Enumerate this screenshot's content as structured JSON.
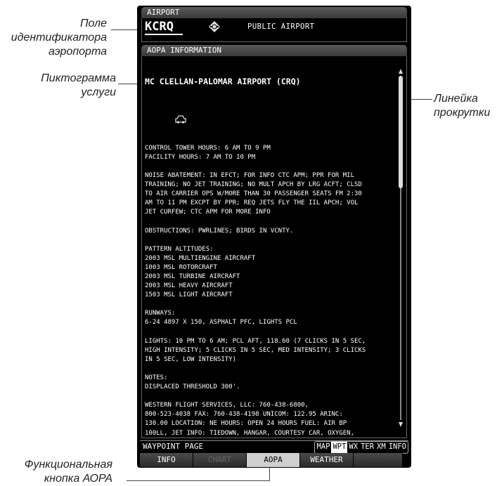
{
  "callouts": {
    "ident_field": [
      "Поле",
      "идентификатора",
      "аэропорта"
    ],
    "service_icon": [
      "Пиктограмма",
      "услуги"
    ],
    "scroll_bar": [
      "Линейка",
      "прокрутки"
    ],
    "aopa_softkey": [
      "Функциональная",
      "кнопка АОРА"
    ]
  },
  "airport": {
    "header": "AIRPORT",
    "identifier": "KCRQ",
    "icon": "public-airport-icon",
    "type": "PUBLIC AIRPORT"
  },
  "aopa": {
    "header": "AOPA INFORMATION",
    "title": "MC CLELLAN-PALOMAR AIRPORT (CRQ)",
    "service_icon": "car-icon",
    "lines": [
      "",
      "CONTROL TOWER HOURS: 6 AM TO 9 PM",
      "FACILITY HOURS: 7 AM TO 10 PM",
      "",
      "NOISE ABATEMENT: IN EFCT; FOR INFO CTC APM; PPR FOR MIL",
      "TRAINING; NO JET TRAINING; NO MULT APCH BY LRG ACFT; CLSD",
      "TO AIR CARRIER OPS W/MORE THAN 30 PASSENGER SEATS FM 2:30",
      "AM TO 11 PM EXCPT BY PPR; REQ JETS FLY THE IIL APCH; VOL",
      "JET CURFEW; CTC APM FOR MORE INFO",
      "",
      "OBSTRUCTIONS: PWRLINES; BIRDS IN VCNTY.",
      "",
      "PATTERN ALTITUDES:",
      "2003 MSL MULTIENGINE AIRCRAFT",
      "1003 MSL ROTORCRAFT",
      "2003 MSL TURBINE AIRCRAFT",
      "2003 MSL HEAVY AIRCRAFT",
      "1503 MSL LIGHT AIRCRAFT",
      "",
      "RUNWAYS:",
      "6-24 4897 X 150, ASPHALT PFC, LIGHTS PCL",
      "",
      "LIGHTS: 10 PM TO 6 AM; PCL AFT, 118.60 (7 CLICKS IN 5 SEC,",
      "HIGH INTENSITY; 5 CLICKS IN 5 SEC, MED INTENSITY; 3 CLICKS",
      "IN 5 SEC, LOW INTENSITY)",
      "",
      "NOTES:",
      "DISPLACED THRESHOLD 300'.",
      "",
      "WESTERN FLIGHT SERVICES, LLC: 760-438-6800,",
      "800-523-4038 FAX: 760-438-4198 UNICOM: 122.95 ARINC:",
      "130.00 LOCATION: NE HOURS: OPEN 24 HOURS FUEL: AIR BP",
      "100LL, JET INFO: TIEDOWN, HANGAR, COURTESY CAR, OXYGEN,"
    ]
  },
  "page_group": {
    "label": "WAYPOINT PAGE",
    "groups": [
      "MAP",
      "WPT",
      "WX",
      "TER",
      "XM",
      "INFO"
    ],
    "active": "WPT"
  },
  "softkeys": [
    {
      "label": "INFO",
      "state": "normal"
    },
    {
      "label": "CHART",
      "state": "disabled"
    },
    {
      "label": "AOPA",
      "state": "selected"
    },
    {
      "label": "WEATHER",
      "state": "normal"
    },
    {
      "label": "",
      "state": "empty"
    }
  ],
  "colors": {
    "screen_bg": "#000000",
    "text": "#ffffff",
    "selected_softkey": "#cfcfcf"
  }
}
